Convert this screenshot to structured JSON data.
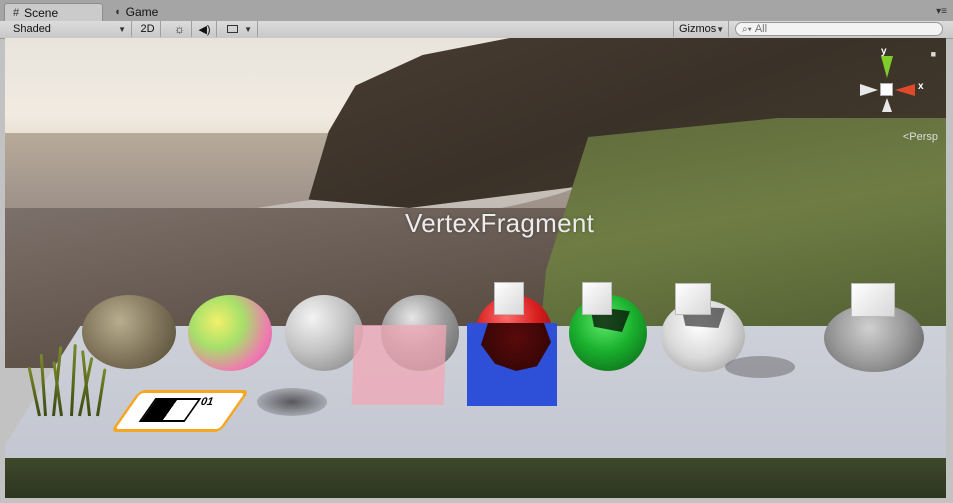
{
  "tabs": [
    {
      "label": "Scene",
      "icon": "grid-icon"
    },
    {
      "label": "Game",
      "icon": "pacman-icon"
    }
  ],
  "toolbar": {
    "shading_mode": "Shaded",
    "mode_2d": "2D",
    "gizmos_label": "Gizmos",
    "search_placeholder": "All"
  },
  "viewport": {
    "scene_text": "VertexFragment",
    "projection_label": "Persp",
    "axis_labels": {
      "y": "y",
      "x": "x"
    }
  },
  "colors": {
    "gizmo_x": "#e04a2a",
    "gizmo_y": "#7fcc2a",
    "gizmo_z": "#3b6bd6",
    "blue_quad": "#2e4fd8",
    "pink_quad": "#f2a7b5",
    "red_sphere": "#d81e1e",
    "green_sphere": "#1ab12e",
    "marker_outline": "#f5a623"
  },
  "marker_text": "01"
}
